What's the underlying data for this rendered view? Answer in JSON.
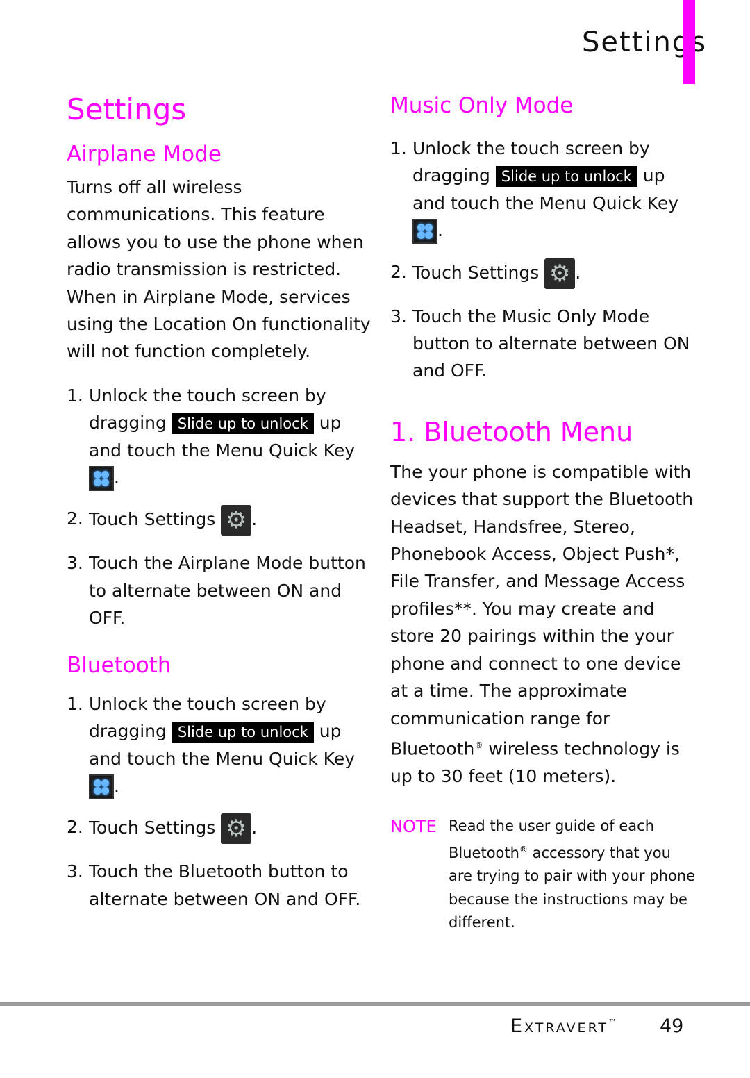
{
  "header": {
    "section_title": "Settings",
    "accent": "#ff00ff"
  },
  "left": {
    "page_title": "Settings",
    "airplane": {
      "title": "Airplane Mode",
      "intro": "Turns off all wireless communications. This feature allows you to use the phone when radio transmission is restricted. When in Airplane Mode, services using the Location On functionality will not function completely.",
      "steps": [
        {
          "num": "1.",
          "a": "Unlock the touch screen by dragging",
          "slide": "Slide up to unlock",
          "b": "up and touch the",
          "kw": "Menu Quick Key",
          "c": "."
        },
        {
          "num": "2.",
          "a": "Touch",
          "kw": "Settings",
          "c": "."
        },
        {
          "num": "3.",
          "a": "Touch the",
          "kw": "Airplane Mode",
          "b": "button to alternate between",
          "on": "ON",
          "and": "and",
          "off": "OFF",
          "c": "."
        }
      ]
    },
    "bluetooth": {
      "title": "Bluetooth",
      "steps": [
        {
          "num": "1.",
          "a": "Unlock the touch screen by dragging",
          "slide": "Slide up to unlock",
          "b": "up and touch the",
          "kw": "Menu Quick Key",
          "c": "."
        },
        {
          "num": "2.",
          "a": "Touch",
          "kw": "Settings",
          "c": "."
        },
        {
          "num": "3.",
          "a": "Touch the",
          "kw": "Bluetooth",
          "b": "button to alternate between",
          "on": "ON",
          "and": "and",
          "off": "OFF",
          "c": "."
        }
      ]
    }
  },
  "right": {
    "music": {
      "title": "Music Only Mode",
      "steps": [
        {
          "num": "1.",
          "a": "Unlock the touch screen by dragging",
          "slide": "Slide up to unlock",
          "b": "up and touch the",
          "kw": "Menu Quick Key",
          "c": "."
        },
        {
          "num": "2.",
          "a": "Touch",
          "kw": "Settings",
          "c": "."
        },
        {
          "num": "3.",
          "a": "Touch the",
          "kw": "Music Only Mode",
          "b": "button to alternate between",
          "on": "ON",
          "and": "and",
          "off": "OFF",
          "c": "."
        }
      ]
    },
    "bt_menu": {
      "title": "1. Bluetooth Menu",
      "body_a": "The your phone is compatible with devices that support the Bluetooth Headset, Handsfree, Stereo, Phonebook Access, Object Push*, File Transfer, and Message Access profiles**. You may create and store 20 pairings within the your phone and connect to one device at a time. The approximate communication range for Bluetooth",
      "reg": "®",
      "body_b": " wireless technology is up to 30 feet (10 meters).",
      "note_label": "NOTE",
      "note_a": "Read the user guide of each Bluetooth",
      "note_b": " accessory that you are trying to pair with your phone because the instructions may be different."
    }
  },
  "footer": {
    "brand": "Extravert",
    "tm": "™",
    "page": "49"
  }
}
